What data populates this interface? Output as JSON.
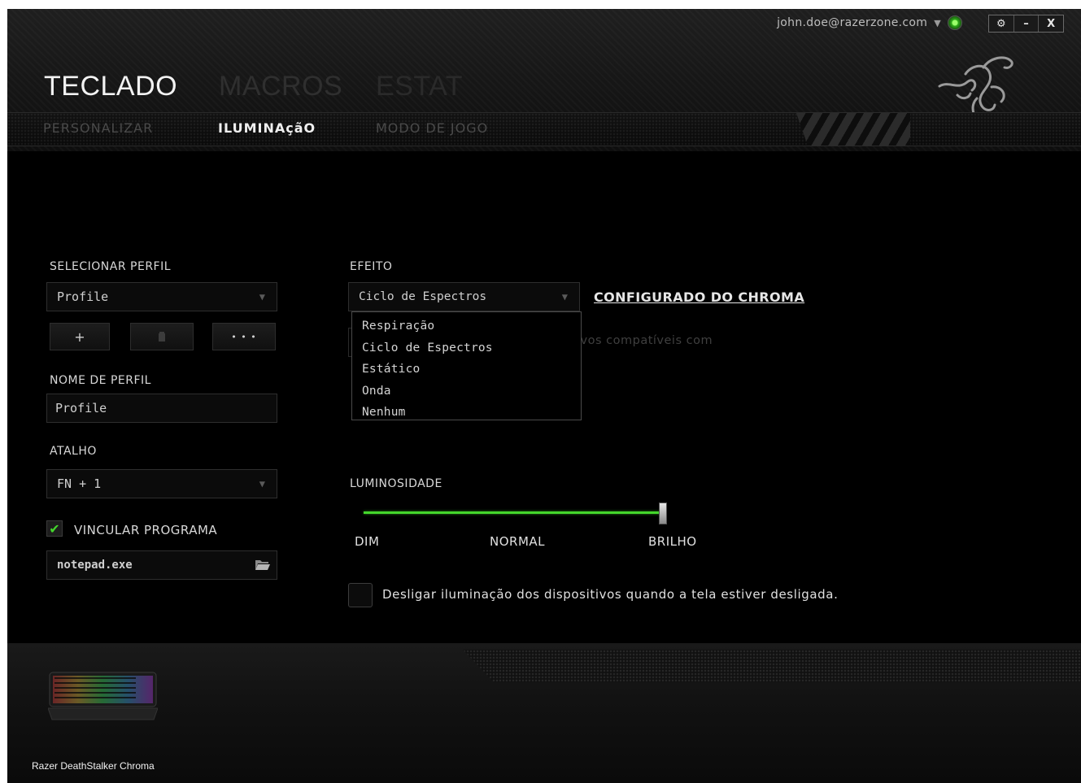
{
  "account": {
    "email": "john.doe@razerzone.com",
    "status_icon": "online-status-icon"
  },
  "window_controls": {
    "settings": "⚙",
    "minimize": "–",
    "close": "X"
  },
  "main_tabs": [
    {
      "label": "TECLADO"
    },
    {
      "label": "MACROS"
    },
    {
      "label": "ESTAT"
    }
  ],
  "sub_tabs": [
    {
      "label": "PERSONALIZAR"
    },
    {
      "label": "ILUMINAçãO"
    },
    {
      "label": "MODO DE JOGO"
    }
  ],
  "profile": {
    "select_label": "SELECIONAR PERFIL",
    "selected": "Profile",
    "add_label": "+",
    "more_label": "• • •",
    "name_label": "NOME DE PERFIL",
    "name_value": "Profile",
    "shortcut_label": "ATALHO",
    "shortcut_value": "FN + 1",
    "link_program_label": "VINCULAR PROGRAMA",
    "link_program_checked": true,
    "program_value": "notepad.exe"
  },
  "effect": {
    "label": "EFEITO",
    "selected": "Ciclo de Espectros",
    "options": [
      "Respiração",
      "Ciclo de Espectros",
      "Estático",
      "Onda",
      "Nenhum"
    ],
    "chroma_link": "CONFIGURADO DO CHROMA",
    "partial_hint": "ivos compatíveis com"
  },
  "brightness": {
    "label": "LUMINOSIDADE",
    "level": 1.0,
    "min_label": "DIM",
    "mid_label": "NORMAL",
    "max_label": "BRILHO"
  },
  "screen_off": {
    "label": "Desligar iluminação dos dispositivos quando a tela estiver desligada.",
    "checked": false
  },
  "device": {
    "name": "Razer DeathStalker Chroma"
  },
  "colors": {
    "accent": "#44d62c",
    "background": "#000000"
  }
}
